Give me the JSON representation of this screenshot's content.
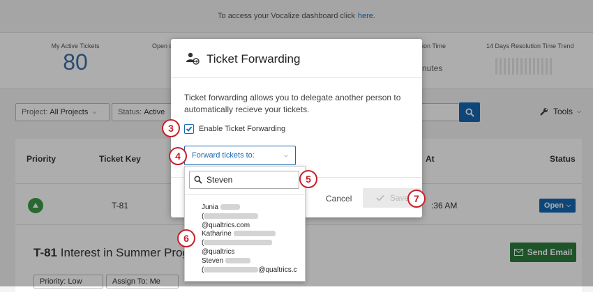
{
  "banner": {
    "text": "To access your Vocalize dashboard click",
    "link": "here."
  },
  "stats": [
    {
      "label": "My Active Tickets",
      "value": "80"
    },
    {
      "label": "Open o",
      "value": ""
    },
    {
      "label": "ion Time",
      "value": "nutes"
    },
    {
      "label": "14 Days Resolution Time Trend",
      "value": ""
    }
  ],
  "filters": {
    "project_key": "Project:",
    "project_value": "All Projects",
    "status_key": "Status:",
    "status_value": "Active",
    "tools_label": "Tools"
  },
  "table": {
    "headers": {
      "priority": "Priority",
      "ticket_key": "Ticket Key",
      "at": "At",
      "status": "Status"
    },
    "row": {
      "ticket": "T-81",
      "time": ":36 AM",
      "status": "Open"
    },
    "detail": {
      "ticket": "T-81",
      "title": "Interest in Summer Progr",
      "send_email": "Send Email",
      "priority_btn": "Priority: Low",
      "assign_btn": "Assign To: Me"
    }
  },
  "modal": {
    "title": "Ticket Forwarding",
    "description": "Ticket forwarding allows you to delegate another person to automatically recieve your tickets.",
    "enable_label": "Enable Ticket Forwarding",
    "forward_label": "Forward tickets to:",
    "cancel_label": "Cancel",
    "save_label": "Save"
  },
  "dropdown": {
    "search_value": "Steven",
    "people": [
      {
        "first": "Junia",
        "email_suffix": "@qualtrics.com"
      },
      {
        "first": "Katharine",
        "email_suffix": "@qualtrics"
      },
      {
        "first": "Steven",
        "email_suffix": "@qualtrics.c"
      }
    ]
  },
  "callouts": [
    "3",
    "4",
    "5",
    "6",
    "7"
  ],
  "colors": {
    "primary": "#1567b3",
    "callout": "#c8202a",
    "success": "#2e7d40",
    "priority_low": "#3f9a4a"
  }
}
